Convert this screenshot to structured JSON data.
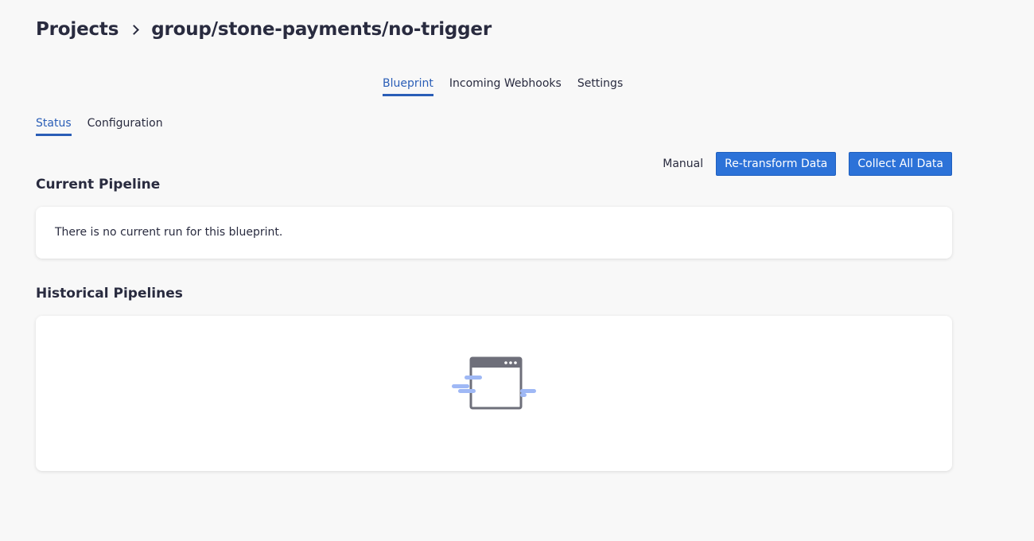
{
  "breadcrumb": {
    "root": "Projects",
    "current": "group/stone-payments/no-trigger"
  },
  "top_tabs": [
    {
      "label": "Blueprint",
      "active": true
    },
    {
      "label": "Incoming Webhooks",
      "active": false
    },
    {
      "label": "Settings",
      "active": false
    }
  ],
  "sub_tabs": [
    {
      "label": "Status",
      "active": true
    },
    {
      "label": "Configuration",
      "active": false
    }
  ],
  "actions": {
    "mode_label": "Manual",
    "retransform_label": "Re-transform Data",
    "collect_label": "Collect All Data"
  },
  "current_pipeline": {
    "title": "Current Pipeline",
    "empty_message": "There is no current run for this blueprint."
  },
  "historical_pipelines": {
    "title": "Historical Pipelines",
    "empty_icon": "empty-window-icon"
  },
  "colors": {
    "accent": "#2a5eb7",
    "button": "#2c72d8",
    "background": "#f8f8f8",
    "text": "#292b3f",
    "icon_gray": "#6e6f7a",
    "icon_blue": "#9fb8f5"
  }
}
